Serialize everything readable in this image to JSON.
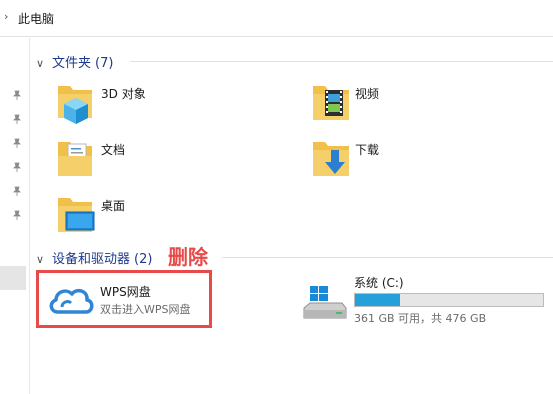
{
  "address": {
    "crumb": "此电脑"
  },
  "groups": {
    "folders": {
      "title": "文件夹",
      "count": "(7)"
    },
    "devices": {
      "title": "设备和驱动器",
      "count": "(2)"
    }
  },
  "folders": [
    {
      "name": "3D 对象",
      "icon": "3d-objects-folder-icon"
    },
    {
      "name": "视频",
      "icon": "videos-folder-icon"
    },
    {
      "name": "文档",
      "icon": "documents-folder-icon"
    },
    {
      "name": "下载",
      "icon": "downloads-folder-icon"
    },
    {
      "name": "桌面",
      "icon": "desktop-folder-icon"
    }
  ],
  "annotation": {
    "text": "删除",
    "color": "#e84a4a"
  },
  "wps": {
    "title": "WPS网盘",
    "subtitle": "双击进入WPS网盘",
    "icon": "cloud-icon"
  },
  "drive": {
    "name": "系统 (C:)",
    "free_text": "361 GB 可用，共 476 GB",
    "used_fraction": 0.24,
    "icon": "windows-drive-icon",
    "bar_color": "#26a0da"
  },
  "colors": {
    "header_text": "#1e3a8a",
    "folder_yellow": "#f5c74a",
    "highlight_red": "#e84a4a"
  }
}
